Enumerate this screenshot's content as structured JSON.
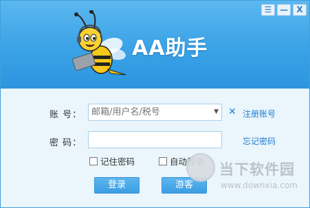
{
  "window": {
    "title": "AA助手",
    "controls": {
      "menu": "☰",
      "minimize": "—",
      "close": "X"
    }
  },
  "form": {
    "account_label": "账 号：",
    "account_placeholder": "邮箱/用户名/税号",
    "clear_symbol": "✕",
    "register_link": "注册账号",
    "password_label": "密 码：",
    "password_value": "",
    "forgot_link": "忘记密码",
    "remember_password": "记住密码",
    "auto_login": "自动登录",
    "login_button": "登录",
    "guest_button": "游客"
  },
  "watermark": {
    "text": "当下软件园",
    "url": "www.downxia.com"
  },
  "colors": {
    "header_top": "#5cb8ef",
    "header_bottom": "#2c95df",
    "body": "#eaf5fc",
    "link": "#1f7fd1",
    "button": "#3a9ee3"
  },
  "icons": [
    "menu-icon",
    "minimize-icon",
    "close-icon",
    "bee-mascot",
    "dropdown-arrow-icon",
    "clear-icon",
    "watermark-logo"
  ]
}
